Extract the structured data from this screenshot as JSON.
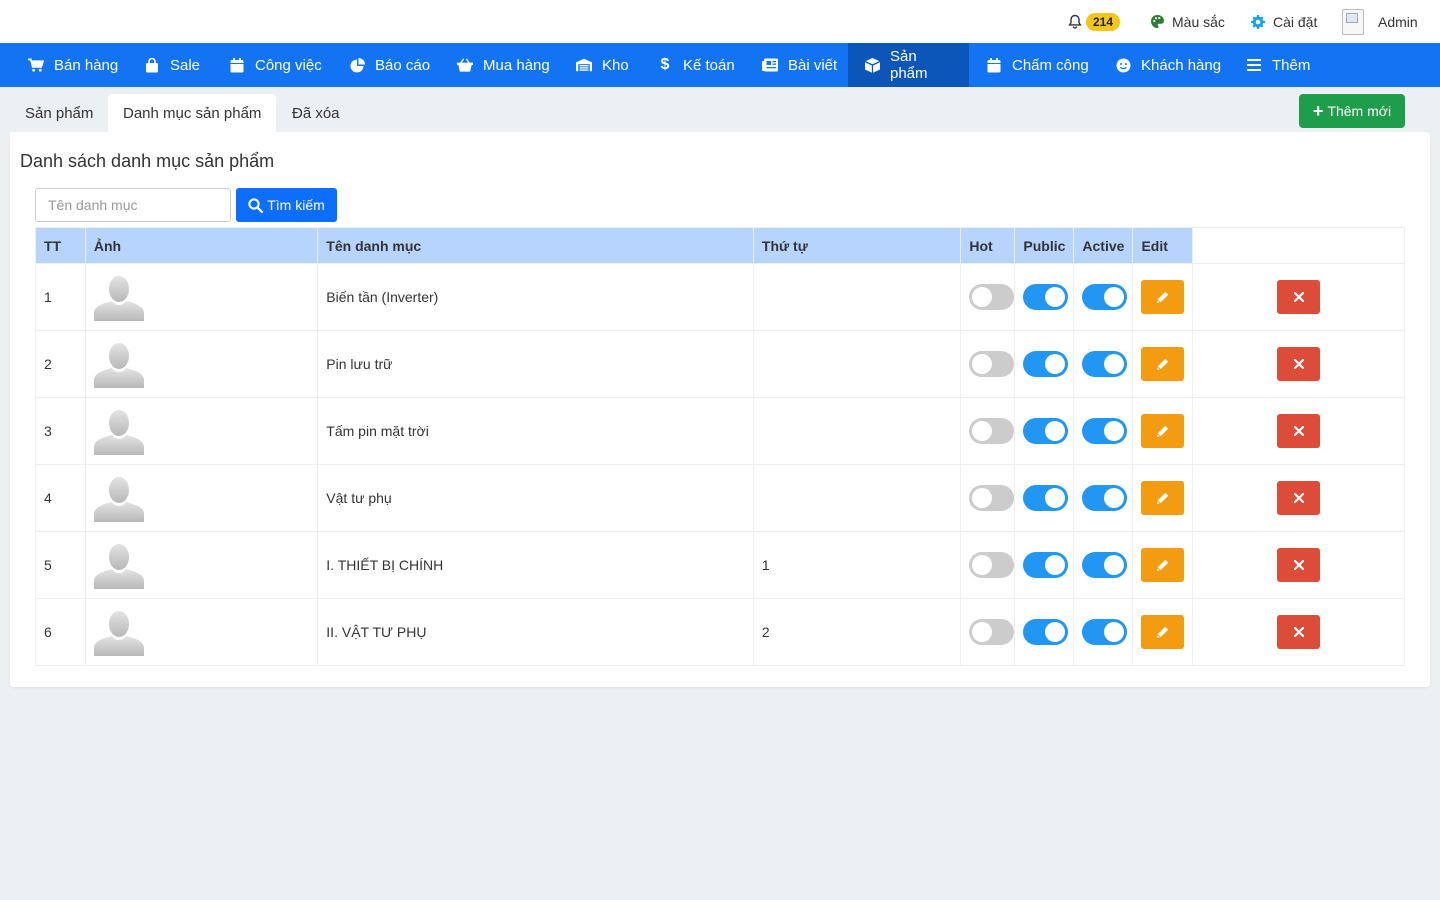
{
  "topbar": {
    "notification_count": "214",
    "color_label": "Màu sắc",
    "settings_label": "Cài đặt",
    "user_name": "Admin"
  },
  "nav": {
    "items": [
      {
        "label": "Bán hàng",
        "icon": "cart-icon"
      },
      {
        "label": "Sale",
        "icon": "bag-icon"
      },
      {
        "label": "Công việc",
        "icon": "calendar-icon"
      },
      {
        "label": "Báo cáo",
        "icon": "pie-chart-icon"
      },
      {
        "label": "Mua hàng",
        "icon": "basket-icon"
      },
      {
        "label": "Kho",
        "icon": "warehouse-icon"
      },
      {
        "label": "Kế toán",
        "icon": "dollar-icon"
      },
      {
        "label": "Bài viết",
        "icon": "newspaper-icon"
      },
      {
        "label": "Sản phẩm",
        "icon": "box-icon"
      },
      {
        "label": "Chấm công",
        "icon": "calendar-icon"
      },
      {
        "label": "Khách hàng",
        "icon": "smile-icon"
      },
      {
        "label": "Thêm",
        "icon": "menu-icon"
      }
    ],
    "active_index": 8
  },
  "tabs": {
    "items": [
      "Sản phẩm",
      "Danh mục sản phẩm",
      "Đã xóa"
    ],
    "active_index": 1
  },
  "add_button_label": "Thêm mới",
  "panel_title": "Danh sách danh mục sản phẩm",
  "search": {
    "placeholder": "Tên danh mục",
    "button_label": "Tìm kiếm"
  },
  "table": {
    "headers": {
      "tt": "TT",
      "image": "Ảnh",
      "name": "Tên danh mục",
      "order": "Thứ tự",
      "hot": "Hot",
      "public": "Public",
      "active": "Active",
      "edit": "Edit"
    },
    "rows": [
      {
        "tt": "1",
        "name": "Biến tần (Inverter)",
        "order": "",
        "hot": false,
        "public": true,
        "active": true
      },
      {
        "tt": "2",
        "name": "Pin lưu trữ",
        "order": "",
        "hot": false,
        "public": true,
        "active": true
      },
      {
        "tt": "3",
        "name": "Tấm pin mặt trời",
        "order": "",
        "hot": false,
        "public": true,
        "active": true
      },
      {
        "tt": "4",
        "name": "Vật tư phụ",
        "order": "",
        "hot": false,
        "public": true,
        "active": true
      },
      {
        "tt": "5",
        "name": "I. THIẾT BỊ CHÍNH",
        "order": "1",
        "hot": false,
        "public": true,
        "active": true
      },
      {
        "tt": "6",
        "name": "II. VẬT TƯ PHỤ",
        "order": "2",
        "hot": false,
        "public": true,
        "active": true
      }
    ]
  },
  "colors": {
    "nav_bg": "#1274f2",
    "nav_active_bg": "#0b56b8",
    "header_bg": "#b6d4fe",
    "toggle_on": "#2196f3",
    "toggle_off": "#cccccc",
    "edit_button": "#f39c12",
    "delete_button": "#dd4b39",
    "add_button": "#1e9e4a",
    "badge": "#f5c518"
  }
}
